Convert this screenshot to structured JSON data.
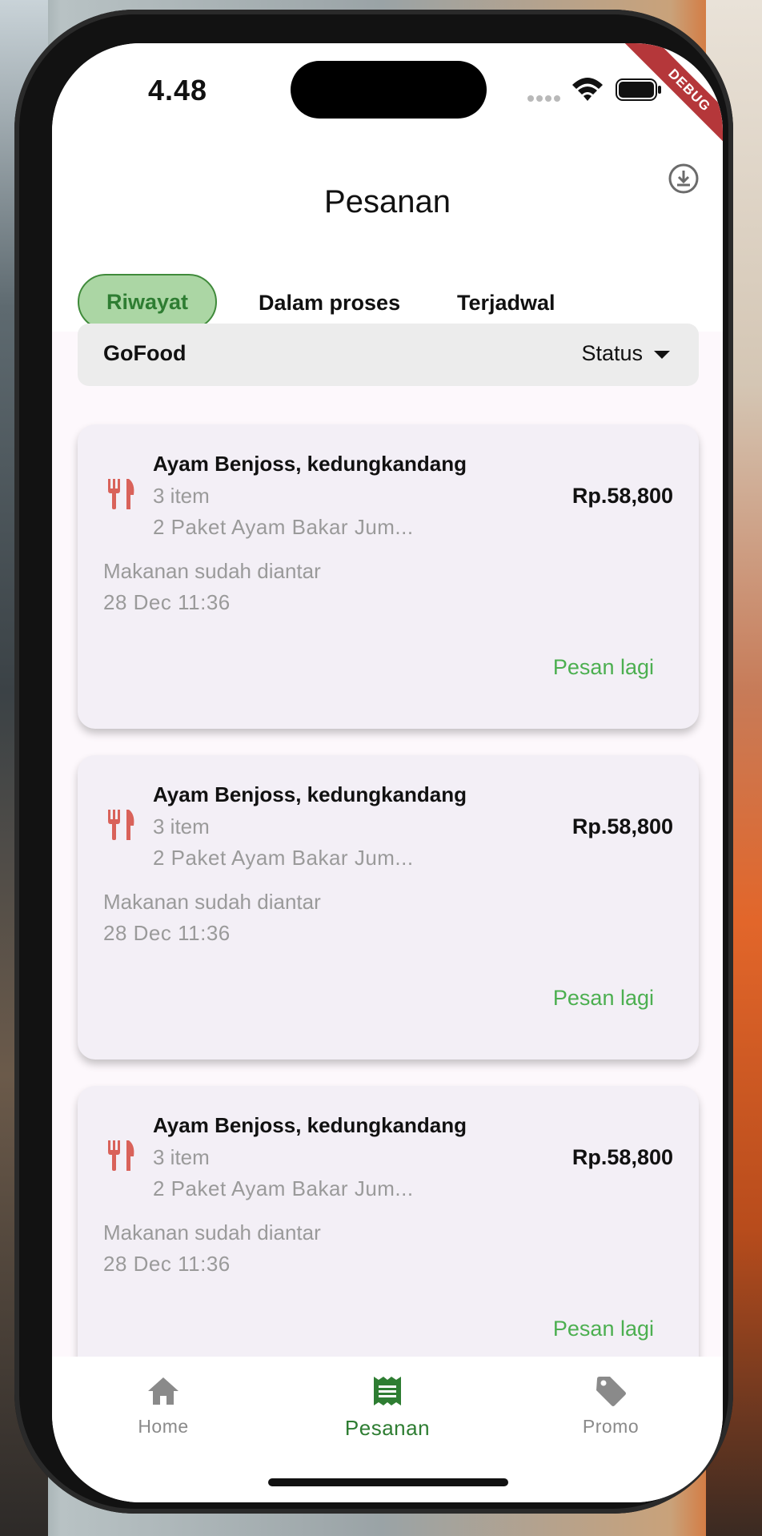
{
  "status_bar": {
    "time": "4.48",
    "debug_label": "DEBUG"
  },
  "app_bar": {
    "title": "Pesanan",
    "download_icon": "download-circle-icon"
  },
  "tabs": [
    {
      "label": "Riwayat",
      "active": true
    },
    {
      "label": "Dalam proses",
      "active": false
    },
    {
      "label": "Terjadwal",
      "active": false
    }
  ],
  "filter": {
    "service": "GoFood",
    "status_label": "Status"
  },
  "orders": [
    {
      "restaurant": "Ayam Benjoss, kedungkandang",
      "item_count": "3 item",
      "description": "2 Paket Ayam Bakar Jum...",
      "price": "Rp.58,800",
      "status": "Makanan sudah diantar",
      "date": "28 Dec 11:36",
      "reorder_label": "Pesan lagi"
    },
    {
      "restaurant": "Ayam Benjoss, kedungkandang",
      "item_count": "3 item",
      "description": "2 Paket Ayam Bakar Jum...",
      "price": "Rp.58,800",
      "status": "Makanan sudah diantar",
      "date": "28 Dec 11:36",
      "reorder_label": "Pesan lagi"
    },
    {
      "restaurant": "Ayam Benjoss, kedungkandang",
      "item_count": "3 item",
      "description": "2 Paket Ayam Bakar Jum...",
      "price": "Rp.58,800",
      "status": "Makanan sudah diantar",
      "date": "28 Dec 11:36",
      "reorder_label": "Pesan lagi"
    }
  ],
  "bottom_nav": [
    {
      "label": "Home",
      "icon": "home-icon",
      "active": false
    },
    {
      "label": "Pesanan",
      "icon": "receipt-icon",
      "active": true
    },
    {
      "label": "Promo",
      "icon": "tag-icon",
      "active": false
    }
  ],
  "colors": {
    "accent": "#4caf50",
    "tab_active_bg": "#abd6a4",
    "icon_red": "#d9625a",
    "debug_red": "#b5373a"
  }
}
